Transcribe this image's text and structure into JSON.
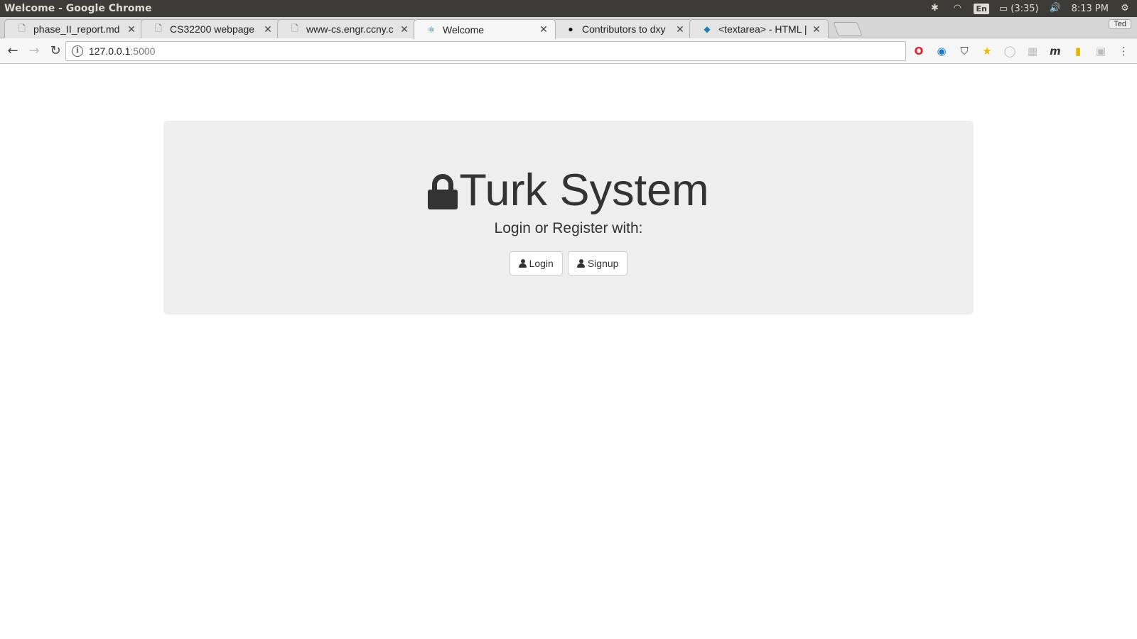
{
  "os": {
    "window_title": "Welcome - Google Chrome",
    "keyboard_lang": "En",
    "battery": "(3:35)",
    "clock": "8:13 PM"
  },
  "browser": {
    "tabs": [
      {
        "label": "phase_II_report.md",
        "icon": "file-icon"
      },
      {
        "label": "CS32200 webpage",
        "icon": "file-icon"
      },
      {
        "label": "www-cs.engr.ccny.c",
        "icon": "file-icon"
      },
      {
        "label": "Welcome",
        "icon": "react-icon",
        "active": true
      },
      {
        "label": "Contributors to dxy",
        "icon": "github-icon"
      },
      {
        "label": "<textarea> - HTML |",
        "icon": "mdn-icon"
      }
    ],
    "profile": "Ted",
    "address": {
      "host": "127.0.0.1",
      "port": ":5000"
    },
    "extensions": [
      "opera-icon",
      "eye-extension-icon",
      "pocket-icon",
      "star-icon",
      "circle-extension-icon",
      "grid-extension-icon",
      "m-extension-icon",
      "yellow-extension-icon",
      "grey-extension-icon",
      "menu-icon"
    ]
  },
  "page": {
    "title": "Turk System",
    "subtitle": "Login or Register with:",
    "login_label": "Login",
    "signup_label": "Signup"
  },
  "colors": {
    "jumbotron_bg": "#eeeeee",
    "text": "#333333",
    "os_bar": "#3c3b37"
  }
}
